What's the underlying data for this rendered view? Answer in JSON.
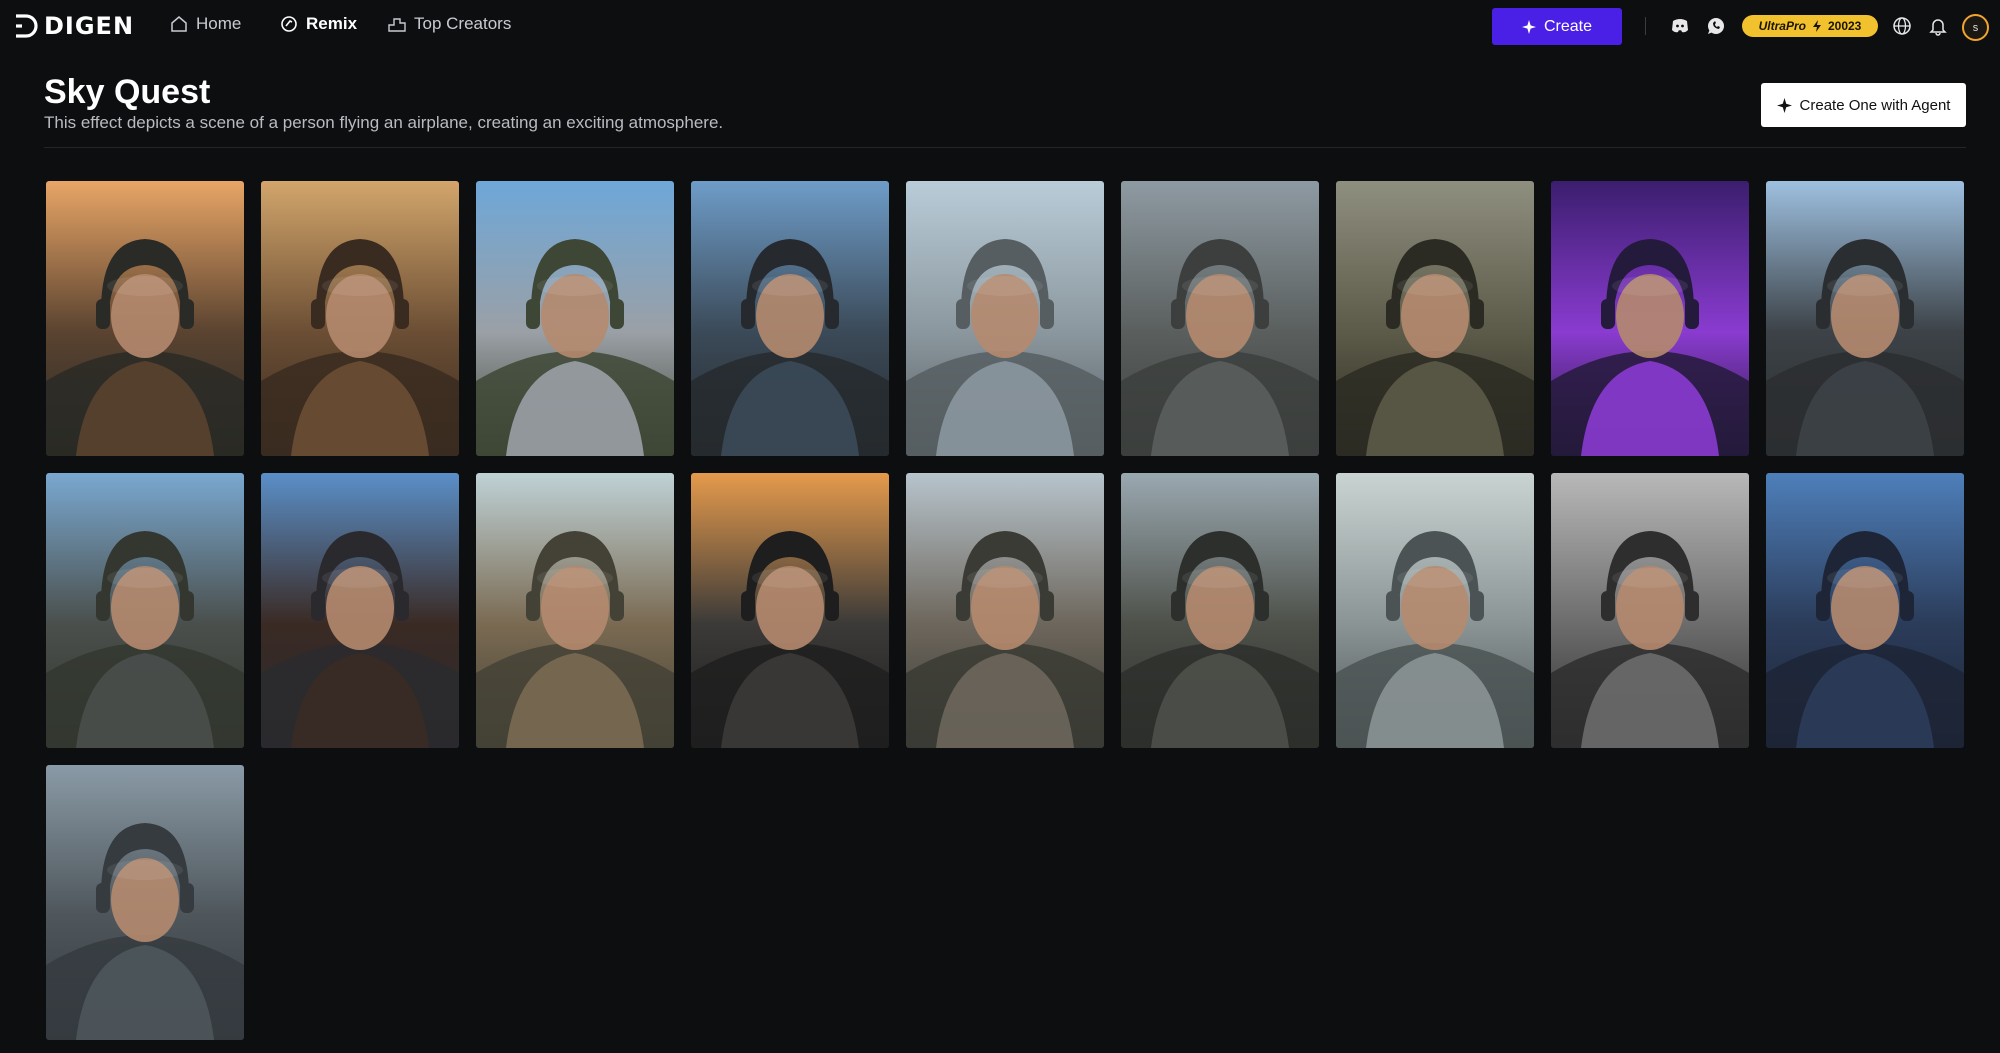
{
  "brand": {
    "name": "DIGEN"
  },
  "nav": {
    "home": "Home",
    "remix": "Remix",
    "top_creators": "Top Creators"
  },
  "header_actions": {
    "create": "Create",
    "plan": "UltraPro",
    "credits": "20023",
    "avatar_initial": "s"
  },
  "page": {
    "title": "Sky Quest",
    "description": "This effect depicts a scene of a person flying an airplane, creating an exciting atmosphere.",
    "agent_button": "Create One with Agent"
  },
  "cards": [
    {
      "name": "pilot-sunset-helmet",
      "palette": [
        "#e8a566",
        "#5a4330",
        "#2a2a26"
      ]
    },
    {
      "name": "vintage-aviator-goggles",
      "palette": [
        "#d2a56b",
        "#6b4e34",
        "#3a2b20"
      ]
    },
    {
      "name": "grey-haired-pilot-headset",
      "palette": [
        "#6ea7d8",
        "#9aa0a6",
        "#3e4635"
      ]
    },
    {
      "name": "pilot-cockpit-blue-sky",
      "palette": [
        "#6e9cc8",
        "#3b4a58",
        "#262a2e"
      ]
    },
    {
      "name": "canopy-pilot-clouds",
      "palette": [
        "#b9ccd8",
        "#8b979e",
        "#565e62"
      ]
    },
    {
      "name": "pilot-cockpit-grey",
      "palette": [
        "#8e9aa2",
        "#5a5f5e",
        "#3c3f3d"
      ]
    },
    {
      "name": "bearded-pilot-olive-helmet",
      "palette": [
        "#8f8f80",
        "#5c5a48",
        "#2c2b23"
      ]
    },
    {
      "name": "pilot-purple-neon",
      "palette": [
        "#3b1e6e",
        "#8a3bd0",
        "#241a3b"
      ]
    },
    {
      "name": "pilot-above-clouds",
      "palette": [
        "#9ec0e0",
        "#3c4247",
        "#2b2e30"
      ]
    },
    {
      "name": "navy-pilot-visor",
      "palette": [
        "#7aa8d0",
        "#4a4f4c",
        "#33372f"
      ]
    },
    {
      "name": "pilot-dark-helmet-blue-sky",
      "palette": [
        "#5a8fc8",
        "#3a2a24",
        "#2a2a2e"
      ]
    },
    {
      "name": "smiling-pilot-goggles",
      "palette": [
        "#bfd2d6",
        "#7a6a52",
        "#444236"
      ]
    },
    {
      "name": "pilot-sunset-profile",
      "palette": [
        "#e59a4c",
        "#3b3a38",
        "#1e1e1e"
      ]
    },
    {
      "name": "female-pilot-helmet",
      "palette": [
        "#b7c4cc",
        "#6d665c",
        "#3a3b34"
      ]
    },
    {
      "name": "veteran-pilot-cockpit",
      "palette": [
        "#9aa8b0",
        "#4e514a",
        "#2d2f2c"
      ]
    },
    {
      "name": "canopy-pilot-cloudy-sky",
      "palette": [
        "#c9d4d2",
        "#8b9495",
        "#4b5354"
      ]
    },
    {
      "name": "pilot-black-and-white",
      "palette": [
        "#b8b8b8",
        "#6c6c6c",
        "#2e2e2e"
      ]
    },
    {
      "name": "screaming-pilot-visor",
      "palette": [
        "#4e7fba",
        "#2b3c5a",
        "#1d2536"
      ]
    },
    {
      "name": "pilot-jet-cockpit-overcast",
      "palette": [
        "#8a9aa6",
        "#4e565b",
        "#353b3f"
      ]
    }
  ]
}
